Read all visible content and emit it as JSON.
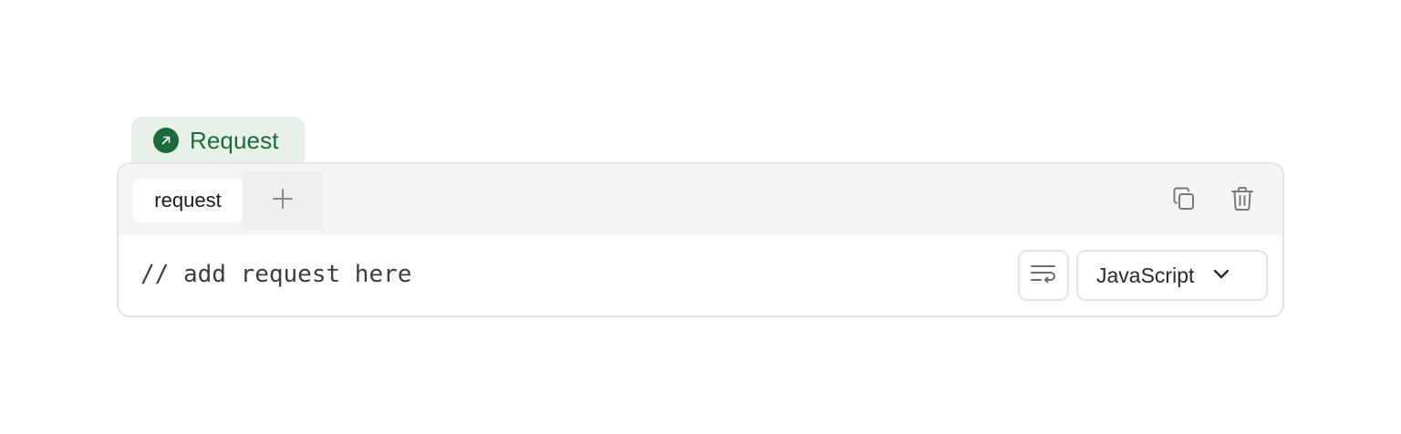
{
  "section": {
    "label": "Request",
    "icon": "arrow-up-right-icon",
    "accent_color": "#1d6b3a",
    "accent_bg": "#e7f1e9"
  },
  "toolbar": {
    "tabs": [
      {
        "label": "request",
        "active": true
      }
    ],
    "add_tab_icon": "plus-icon",
    "actions": [
      {
        "name": "copy",
        "icon": "copy-icon"
      },
      {
        "name": "delete",
        "icon": "trash-icon"
      }
    ]
  },
  "editor": {
    "content": "// add request here",
    "wrap_icon": "wrap-text-icon",
    "language": {
      "selected": "JavaScript",
      "icon": "chevron-down-icon"
    }
  }
}
